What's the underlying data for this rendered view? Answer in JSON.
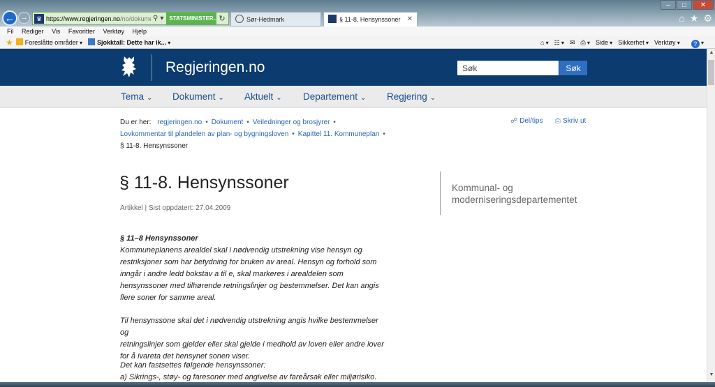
{
  "browser": {
    "url_host": "https://www.regjeringen.no",
    "url_rest": "/no/dokume",
    "security_label": "STATSMINISTER...",
    "tabs": [
      {
        "title": "Sør-Hedmark"
      },
      {
        "title": "§ 11-8. Hensynssoner"
      }
    ],
    "menu": [
      "Fil",
      "Rediger",
      "Vis",
      "Favoritter",
      "Verktøy",
      "Hjelp"
    ],
    "favorites": [
      {
        "label": "Foreslåtte områder"
      },
      {
        "label": "Sjokktall: Dette har ik..."
      }
    ],
    "command_bar": [
      "Side",
      "Sikkerhet",
      "Verktøy"
    ]
  },
  "site": {
    "name": "Regjeringen.no",
    "search_placeholder": "Søk",
    "search_button": "Søk",
    "nav": [
      "Tema",
      "Dokument",
      "Aktuelt",
      "Departement",
      "Regjering"
    ]
  },
  "breadcrumb": {
    "prefix": "Du er her:",
    "items": [
      "regjeringen.no",
      "Dokument",
      "Veiledninger og brosjyrer",
      "Lovkommentar til plandelen av plan- og bygningsloven",
      "Kapittel 11. Kommuneplan"
    ],
    "current": "§ 11-8. Hensynssoner"
  },
  "actions": {
    "share": "Del/tips",
    "print": "Skriv ut"
  },
  "article": {
    "title": "§ 11-8. Hensynssoner",
    "meta": "Artikkel | Sist oppdatert: 27.04.2009",
    "department": "Kommunal- og moderniseringsdepartementet",
    "law_heading": "§ 11–8 Hensynssoner",
    "paragraph_1_lines": [
      "Kommuneplanens arealdel skal i nødvendig utstrekning vise hensyn og",
      "restriksjoner som har betydning for bruken av areal. Hensyn og forhold som",
      "inngår i andre ledd bokstav a til e, skal markeres i arealdelen som",
      "hensynssoner med tilhørende retningslinjer og bestemmelser. Det kan angis",
      "flere soner for samme areal."
    ],
    "paragraph_2_lines": [
      "Til hensynssone skal det i nødvendig utstrekning angis hvilke bestemmelser og",
      "retningslinjer som gjelder eller skal gjelde i medhold av loven eller andre lover",
      "for å ivareta det hensynet sonen viser."
    ],
    "paragraph_3_lines": [
      "Det kan fastsettes følgende hensynssoner:",
      "a) Sikrings-, støy- og faresoner med angivelse av fareårsak eller miljørisiko."
    ]
  },
  "colors": {
    "header_bg": "#0b3b6f",
    "nav_bg": "#ebebeb",
    "link": "#2866b4",
    "search_button": "#2f6fc1"
  }
}
